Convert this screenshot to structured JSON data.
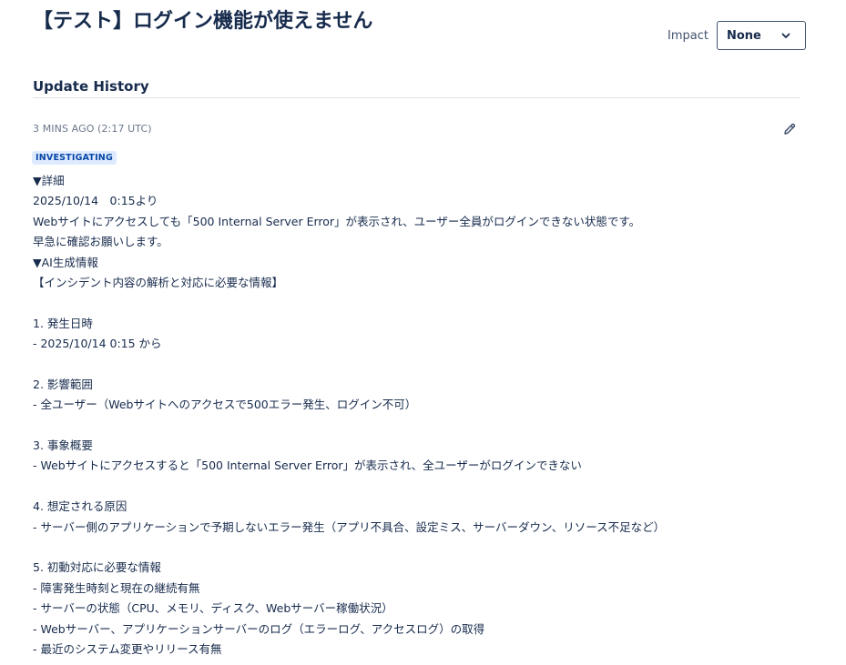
{
  "header": {
    "title": "【テスト】ログイン機能が使えません",
    "impact_label": "Impact",
    "impact_value": "None"
  },
  "history": {
    "title": "Update History",
    "entry": {
      "timestamp": "3 MINS AGO (2:17 UTC)",
      "status": "INVESTIGATING",
      "lines": [
        "▼詳細",
        "2025/10/14　0:15より",
        "Webサイトにアクセスしても「500 Internal Server Error」が表示され、ユーザー全員がログインできない状態です。",
        "早急に確認お願いします。",
        "▼AI生成情報",
        "【インシデント内容の解析と対応に必要な情報】",
        "",
        "1. 発生日時",
        "- 2025/10/14 0:15 から",
        "",
        "2. 影響範囲",
        "- 全ユーザー（Webサイトへのアクセスで500エラー発生、ログイン不可）",
        "",
        "3. 事象概要",
        "- Webサイトにアクセスすると「500 Internal Server Error」が表示され、全ユーザーがログインできない",
        "",
        "4. 想定される原因",
        "- サーバー側のアプリケーションで予期しないエラー発生（アプリ不具合、設定ミス、サーバーダウン、リソース不足など）",
        "",
        "5. 初動対応に必要な情報",
        "- 障害発生時刻と現在の継続有無",
        "- サーバーの状態（CPU、メモリ、ディスク、Webサーバー稼働状況）",
        "- Webサーバー、アプリケーションサーバーのログ（エラーログ、アクセスログ）の取得",
        "- 最近のシステム変更やリリース有無"
      ]
    }
  },
  "icons": {
    "edit": "pencil-icon",
    "impact_dropdown": "chevron-down-icon"
  },
  "colors": {
    "text": "#172b4d",
    "muted": "#6b778c",
    "badge_bg": "#deebff",
    "badge_text": "#0747a6",
    "divider": "#dfe1e6"
  }
}
